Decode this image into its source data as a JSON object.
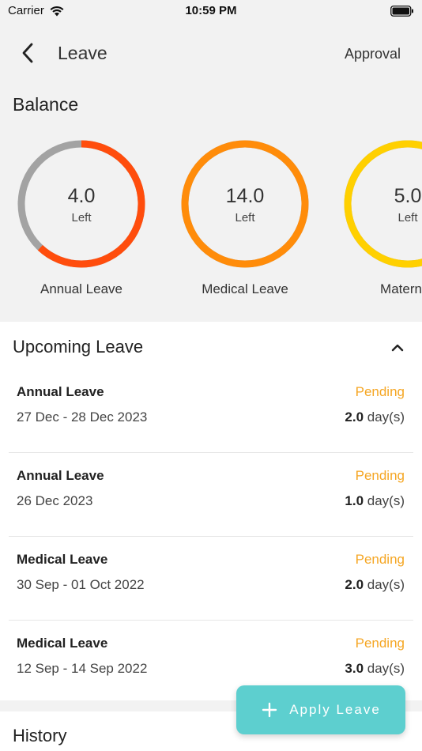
{
  "status_bar": {
    "carrier": "Carrier",
    "time": "10:59 PM"
  },
  "header": {
    "title": "Leave",
    "approval_label": "Approval",
    "back_icon": "chevron-left-icon"
  },
  "balance": {
    "heading": "Balance",
    "items": [
      {
        "value": "4.0",
        "sub": "Left",
        "label": "Annual Leave",
        "fraction_used": 0.62,
        "color": "#ff4d0d",
        "track_color": "#a3a3a3"
      },
      {
        "value": "14.0",
        "sub": "Left",
        "label": "Medical Leave",
        "fraction_used": 1.0,
        "color": "#ff8c0a",
        "track_color": "#a3a3a3"
      },
      {
        "value": "5.0",
        "sub": "Left",
        "label": "Maternity",
        "fraction_used": 1.0,
        "color": "#ffd000",
        "track_color": "#a3a3a3"
      }
    ]
  },
  "upcoming": {
    "title": "Upcoming Leave",
    "collapse_icon": "chevron-up-icon",
    "unit": "day(s)",
    "items": [
      {
        "type": "Annual Leave",
        "dates": "27 Dec - 28 Dec 2023",
        "status": "Pending",
        "days": "2.0"
      },
      {
        "type": "Annual Leave",
        "dates": "26 Dec 2023",
        "status": "Pending",
        "days": "1.0"
      },
      {
        "type": "Medical Leave",
        "dates": "30 Sep - 01 Oct 2022",
        "status": "Pending",
        "days": "2.0"
      },
      {
        "type": "Medical Leave",
        "dates": "12 Sep - 14 Sep 2022",
        "status": "Pending",
        "days": "3.0"
      }
    ]
  },
  "history": {
    "title": "History"
  },
  "fab": {
    "label": "Apply Leave",
    "icon": "plus-icon",
    "color": "#5dcfcf"
  },
  "colors": {
    "pending": "#f5a623",
    "background": "#f2f2f2"
  }
}
